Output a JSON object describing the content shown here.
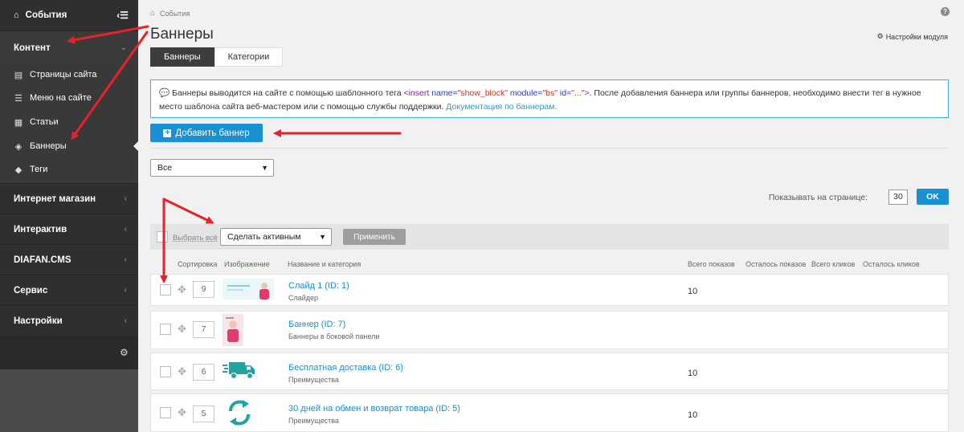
{
  "sidebar": {
    "events": "События",
    "content": "Контент",
    "sub_items": [
      {
        "label": "Страницы сайта",
        "icon": "page-icon"
      },
      {
        "label": "Меню на сайте",
        "icon": "menu-icon"
      },
      {
        "label": "Статьи",
        "icon": "article-icon"
      },
      {
        "label": "Баннеры",
        "icon": "banner-icon"
      },
      {
        "label": "Теги",
        "icon": "tag-icon"
      }
    ],
    "sections": [
      "Интернет магазин",
      "Интерактив",
      "DIAFAN.CMS",
      "Сервис",
      "Настройки"
    ]
  },
  "breadcrumb": "События",
  "page_title": "Баннеры",
  "module_settings": "Настройки модуля",
  "tabs": [
    "Баннеры",
    "Категории"
  ],
  "info": {
    "text1": "Баннеры выводится на сайте с помощью шаблонного тега ",
    "tag_open": "<insert",
    "attr_name": " name=",
    "val_name": "\"show_block\"",
    "attr_module": " module=",
    "val_module": "\"bs\"",
    "attr_id": " id=",
    "val_id": "\"...\"",
    "tag_close": ">",
    "text2": ". После добавления баннера или группы баннеров, необходимо внести тег в нужное место шаблона сайта веб-мастером или с помощью службы поддержки. ",
    "link": "Документация по баннерам."
  },
  "add_button": "Добавить баннер",
  "filter_value": "Все",
  "per_page_label": "Показывать на странице:",
  "per_page_value": "30",
  "ok_button": "OK",
  "select_all": "Выбрать всё",
  "action_value": "Сделать активным",
  "apply_button": "Применить",
  "columns": [
    "Сортировка",
    "Изображение",
    "Название и категория",
    "Всего показов",
    "Осталось показов",
    "Всего кликов",
    "Осталось кликов"
  ],
  "rows": [
    {
      "sort": "9",
      "title": "Слайд 1 (ID: 1)",
      "category": "Слайдер",
      "shows": "10"
    },
    {
      "sort": "7",
      "title": "Баннер (ID: 7)",
      "category": "Баннеры в боковой панели",
      "shows": ""
    },
    {
      "sort": "6",
      "title": "Бесплатная доставка (ID: 6)",
      "category": "Преимущества",
      "shows": "10"
    },
    {
      "sort": "5",
      "title": "30 дней на обмен и возврат товара (ID: 5)",
      "category": "Преимущества",
      "shows": "10"
    }
  ],
  "colors": {
    "sidebar": "#2f2f2f",
    "accent": "#1a8fd1",
    "arrow": "#e8212b",
    "delivery_icon": "#1fa3a3"
  }
}
